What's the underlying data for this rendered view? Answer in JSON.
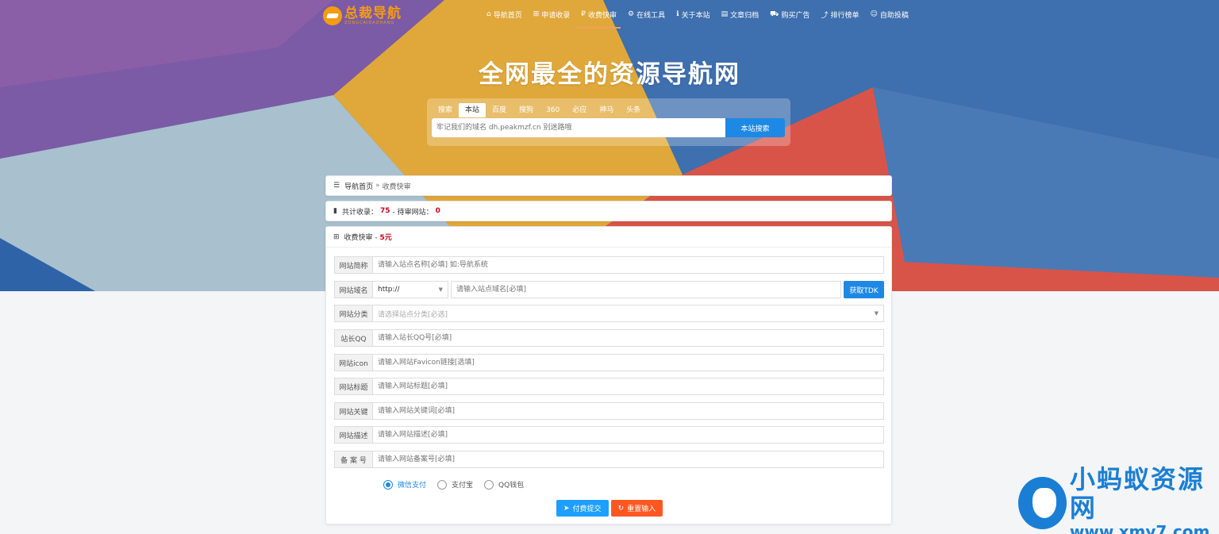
{
  "brand": {
    "title": "总裁导航",
    "subtitle": "ZONGCAIDAOHANG"
  },
  "nav": [
    {
      "icon": "⌂",
      "label": "导航首页"
    },
    {
      "icon": "⊞",
      "label": "申请收录"
    },
    {
      "icon": "₽",
      "label": "收费快审"
    },
    {
      "icon": "⚙",
      "label": "在线工具"
    },
    {
      "icon": "ℹ",
      "label": "关于本站"
    },
    {
      "icon": "▤",
      "label": "文章归档"
    },
    {
      "icon": "⛟",
      "label": "购买广告"
    },
    {
      "icon": "⤴",
      "label": "排行榜单"
    },
    {
      "icon": "☺",
      "label": "自助投稿"
    }
  ],
  "hero": {
    "title": "全网最全的资源导航网"
  },
  "search": {
    "tabs": [
      "搜索",
      "本站",
      "百度",
      "搜狗",
      "360",
      "必应",
      "神马",
      "头条"
    ],
    "placeholder": "牢记我们的域名 dh.peakmzf.cn 别迷路哦",
    "button": "本站搜索"
  },
  "breadcrumb": {
    "home": "导航首页",
    "sep": "»",
    "current": "收费快审"
  },
  "stats": {
    "label_total": "共计收录：",
    "total": "75",
    "label_pending": "- 待审网站：",
    "pending": "0"
  },
  "form": {
    "title": "收费快审 - ",
    "price": "5元",
    "fields": [
      {
        "label": "网站简称",
        "placeholder": "请输入站点名称[必填] 如:导航系统"
      },
      {
        "label": "网站域名",
        "protocol": "http://",
        "placeholder": "请输入站点域名[必填]",
        "action": "获取TDK"
      },
      {
        "label": "网站分类",
        "placeholder": "请选择站点分类[必选]"
      },
      {
        "label": "站长QQ",
        "placeholder": "请输入站长QQ号[必填]"
      },
      {
        "label": "网站icon",
        "placeholder": "请输入网站Favicon链接[选填]"
      },
      {
        "label": "网站标题",
        "placeholder": "请输入网站标题[必填]"
      },
      {
        "label": "网站关键",
        "placeholder": "请输入网站关键词[必填]"
      },
      {
        "label": "网站描述",
        "placeholder": "请输入网站描述[必填]"
      },
      {
        "label": "备 案 号",
        "placeholder": "请输入网站备案号[必填]"
      }
    ],
    "payments": [
      "微信支付",
      "支付宝",
      "QQ钱包"
    ],
    "submit": "付费提交",
    "reset": "重置输入"
  },
  "watermark": {
    "cn": "小蚂蚁资源网",
    "url": "www.xmy7.com"
  },
  "colors": {
    "primary": "#1e88e5",
    "danger": "#d0021b",
    "orange": "#ff5722",
    "brand": "#f39c12"
  }
}
